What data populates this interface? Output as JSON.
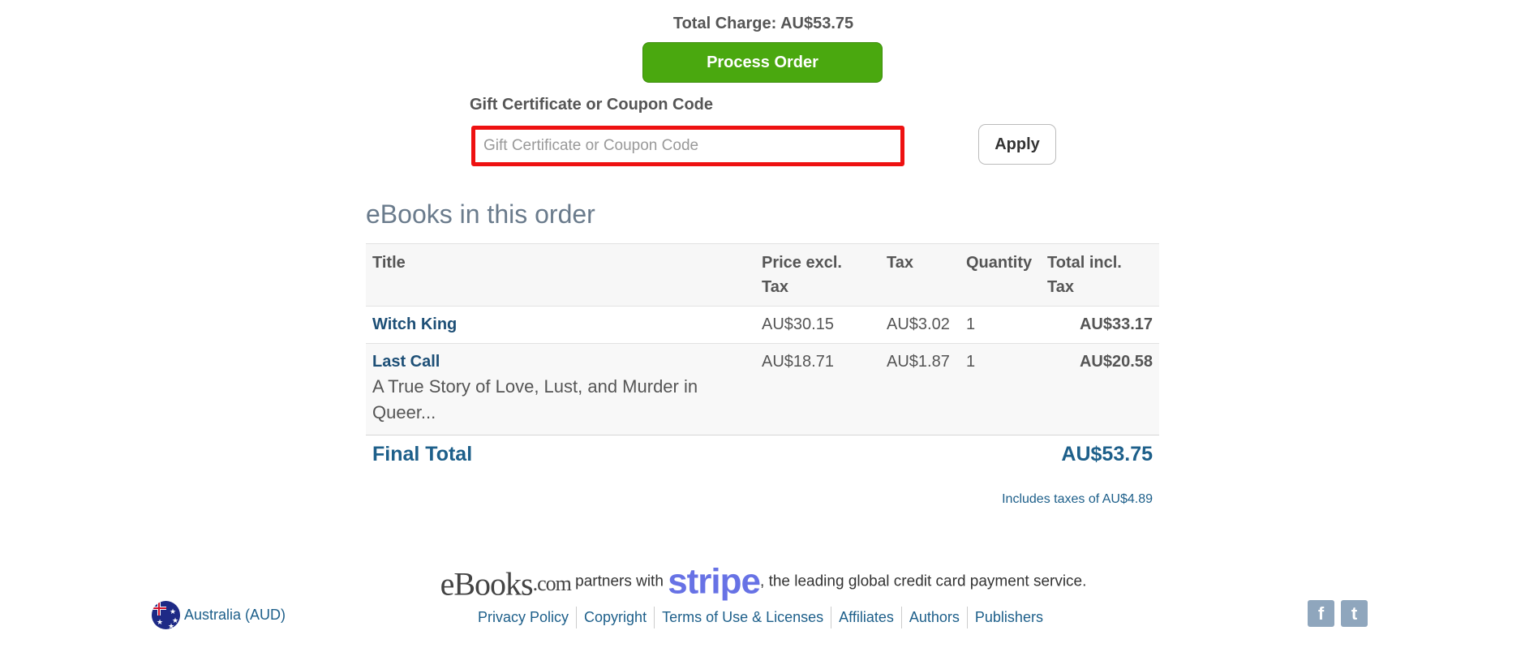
{
  "checkout": {
    "total_charge": "Total Charge: AU$53.75",
    "process_button": "Process Order",
    "coupon_label": "Gift Certificate or Coupon Code",
    "coupon_placeholder": "Gift Certificate or Coupon Code",
    "coupon_value": "",
    "apply_button": "Apply"
  },
  "order": {
    "section_title": "eBooks in this order",
    "columns": {
      "title": "Title",
      "price_line1": "Price excl.",
      "price_line2": "Tax",
      "tax": "Tax",
      "quantity": "Quantity",
      "total_line1": "Total incl.",
      "total_line2": "Tax"
    },
    "items": [
      {
        "title": "Witch King",
        "subtitle": "",
        "price": "AU$30.15",
        "tax": "AU$3.02",
        "quantity": "1",
        "total": "AU$33.17"
      },
      {
        "title": "Last Call",
        "subtitle": "A True Story of Love, Lust, and Murder in Queer...",
        "price": "AU$18.71",
        "tax": "AU$1.87",
        "quantity": "1",
        "total": "AU$20.58"
      }
    ],
    "final_total_label": "Final Total",
    "final_total_value": "AU$53.75",
    "includes_taxes": "Includes taxes of AU$4.89"
  },
  "footer": {
    "brand_main": "eBooks",
    "brand_suffix": ".com",
    "partners_text": " partners with ",
    "stripe_text": "stripe",
    "service_text": ", the leading global credit card payment service.",
    "locale": "Australia (AUD)",
    "links": [
      "Privacy Policy",
      "Copyright",
      "Terms of Use & Licenses",
      "Affiliates",
      "Authors",
      "Publishers"
    ],
    "social": [
      {
        "name": "facebook-icon",
        "glyph": "f"
      },
      {
        "name": "twitter-icon",
        "glyph": "t"
      }
    ]
  },
  "colors": {
    "process_button": "#4aa80f",
    "coupon_border": "#ee1111",
    "link": "#1d5f8a",
    "stripe": "#6772e5"
  }
}
